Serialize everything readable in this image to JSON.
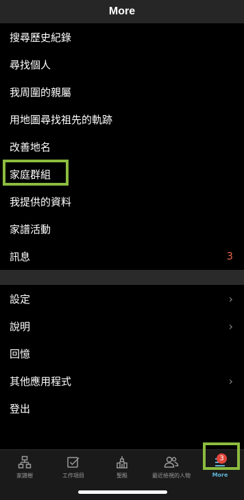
{
  "header": {
    "title": "More"
  },
  "menu_main": [
    {
      "label": "搜尋歷史紀錄"
    },
    {
      "label": "尋找個人"
    },
    {
      "label": "我周圍的親屬"
    },
    {
      "label": "用地圖尋找祖先的軌跡"
    },
    {
      "label": "改善地名"
    },
    {
      "label": "家庭群組"
    },
    {
      "label": "我提供的資料"
    },
    {
      "label": "家譜活動"
    },
    {
      "label": "訊息",
      "count": "3"
    }
  ],
  "menu_secondary": [
    {
      "label": "設定",
      "chevron": "›"
    },
    {
      "label": "說明",
      "chevron": "›"
    },
    {
      "label": "回憶"
    },
    {
      "label": "其他應用程式",
      "chevron": "›"
    },
    {
      "label": "登出"
    }
  ],
  "tabs": [
    {
      "label": "家譜樹",
      "icon": "tree-icon"
    },
    {
      "label": "工作項目",
      "icon": "checklist-icon"
    },
    {
      "label": "聖殿",
      "icon": "temple-icon"
    },
    {
      "label": "最近檢視的人物",
      "icon": "people-icon"
    },
    {
      "label": "More",
      "icon": "menu-icon",
      "badge": "3",
      "active": true
    }
  ],
  "colors": {
    "accent": "#5fb3d6",
    "highlight": "#8cbc3f",
    "badge": "#e0463a",
    "count_text": "#e4624a"
  }
}
